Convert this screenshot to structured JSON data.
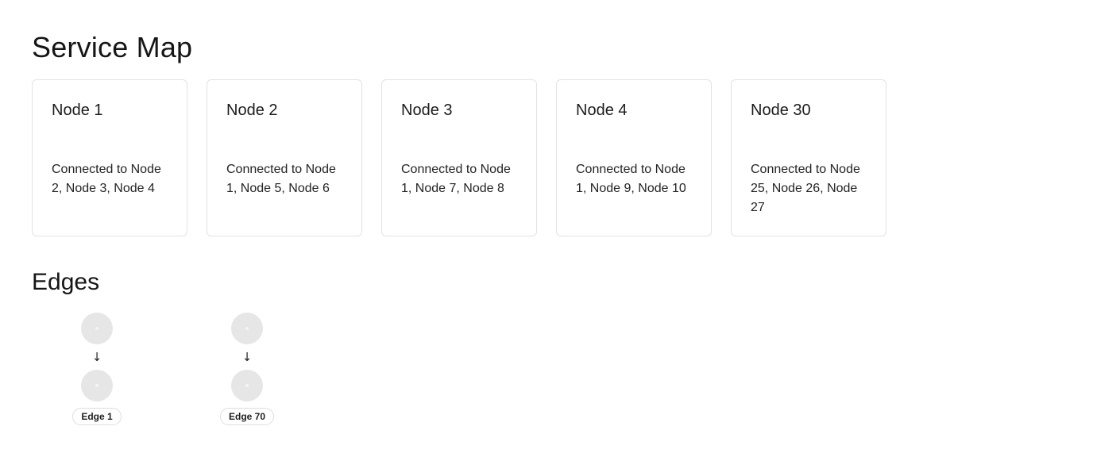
{
  "page": {
    "title": "Service Map"
  },
  "nodes": [
    {
      "title": "Node 1",
      "description": "Connected to Node 2, Node 3, Node 4"
    },
    {
      "title": "Node 2",
      "description": "Connected to Node 1, Node 5, Node 6"
    },
    {
      "title": "Node 3",
      "description": "Connected to Node 1, Node 7, Node 8"
    },
    {
      "title": "Node 4",
      "description": "Connected to Node 1, Node 9, Node 10"
    },
    {
      "title": "Node 30",
      "description": "Connected to Node 25, Node 26, Node 27"
    }
  ],
  "edges_section": {
    "title": "Edges",
    "arrow_glyph": "↓",
    "items": [
      {
        "label": "Edge 1"
      },
      {
        "label": "Edge 70"
      }
    ]
  },
  "colors": {
    "card_border": "#e3e3e3",
    "edge_circle": "#e6e6e6"
  }
}
